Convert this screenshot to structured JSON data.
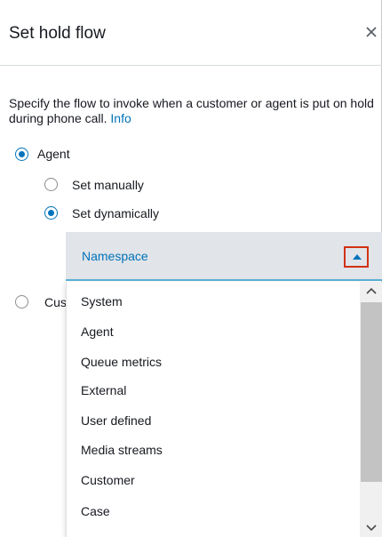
{
  "header": {
    "title": "Set hold flow"
  },
  "description": {
    "text": "Specify the flow to invoke when a customer or agent is put on hold during phone call.",
    "info_link": "Info"
  },
  "radios": {
    "agent": {
      "label": "Agent",
      "checked": true
    },
    "set_manually": {
      "label": "Set manually",
      "checked": false
    },
    "set_dynamically": {
      "label": "Set dynamically",
      "checked": true
    },
    "customer_partial": {
      "label": "Cus",
      "checked": false
    }
  },
  "namespace_select": {
    "label": "Namespace",
    "expanded": true,
    "options": [
      "System",
      "Agent",
      "Queue metrics",
      "External",
      "User defined",
      "Media streams",
      "Customer",
      "Case"
    ]
  },
  "colors": {
    "accent": "#0073bb",
    "highlight_border": "#d13212",
    "select_bg": "#e1e4e8"
  },
  "icons": {
    "close": "close-icon",
    "caret_up": "caret-up-icon",
    "scroll_up": "chevron-up-icon",
    "scroll_down": "chevron-down-icon"
  }
}
